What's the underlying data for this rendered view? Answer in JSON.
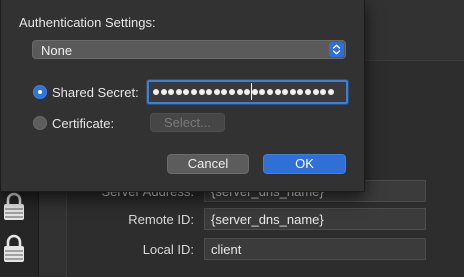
{
  "dialog": {
    "title": "Authentication Settings:",
    "auth_method": {
      "selected": "None"
    },
    "shared_secret": {
      "label": "Shared Secret:",
      "selected": true,
      "masked_chars": 24,
      "caret_index": 13
    },
    "certificate": {
      "label": "Certificate:",
      "selected": false,
      "select_button_label": "Select..."
    },
    "cancel_label": "Cancel",
    "ok_label": "OK"
  },
  "background_form": {
    "server_address": {
      "label": "Server Address:",
      "value": "{server_dns_name}"
    },
    "remote_id": {
      "label": "Remote ID:",
      "value": "{server_dns_name}"
    },
    "local_id": {
      "label": "Local ID:",
      "value": "client"
    }
  },
  "colors": {
    "accent": "#2f6fd6",
    "sheet_bg": "#323232",
    "window_bg": "#2d2d2d"
  }
}
